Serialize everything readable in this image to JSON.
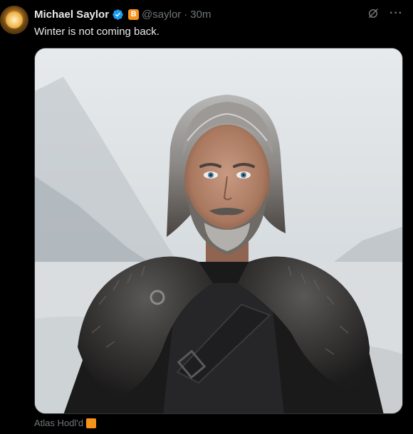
{
  "tweet": {
    "author_name": "Michael Saylor",
    "handle": "@saylor",
    "separator": "·",
    "time": "30m",
    "text": "Winter is not coming back.",
    "badge_letter": "B",
    "media_caption": "Atlas Hodl'd"
  },
  "icons": {
    "verified": "verified-badge-icon",
    "grok": "grok-icon",
    "more": "more-icon"
  },
  "colors": {
    "background": "#000000",
    "verified": "#1d9bf0",
    "bitcoin": "#f7931a",
    "secondary_text": "#71767b"
  }
}
